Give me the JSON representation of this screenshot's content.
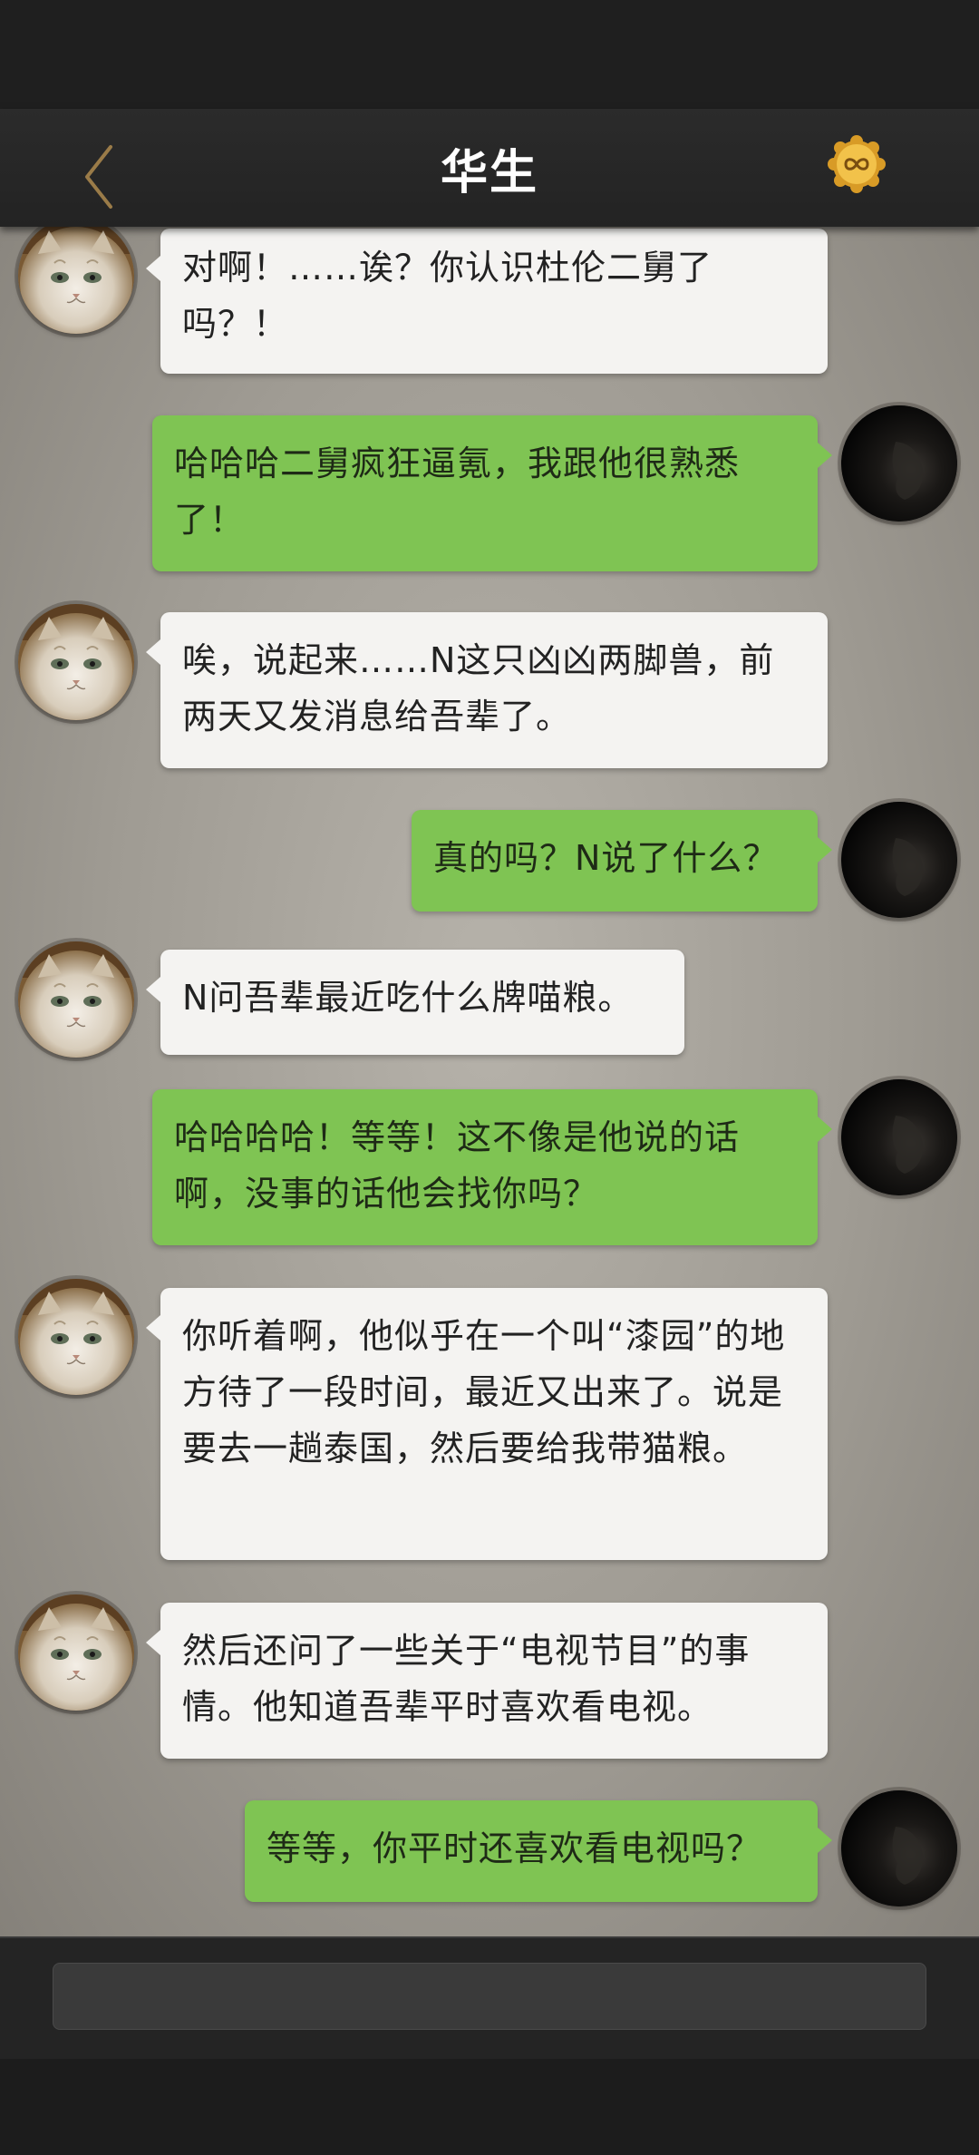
{
  "header": {
    "title": "华生",
    "back_icon": "chevron-left-icon",
    "coin_icon": "infinity-coin-icon"
  },
  "colors": {
    "header_bg": "#2b2b2b",
    "incoming_bubble": "#f4f3f1",
    "outgoing_bubble": "#7fc453",
    "back_icon": "#9a7b48",
    "coin": "#e8b33a"
  },
  "messages": [
    {
      "side": "left",
      "sender": "cat",
      "text": "对啊！……诶？你认识杜伦二舅了吗？！"
    },
    {
      "side": "right",
      "sender": "player",
      "text": "哈哈哈二舅疯狂逼氪，我跟他很熟悉了！"
    },
    {
      "side": "left",
      "sender": "cat",
      "text": "唉，说起来……N这只凶凶两脚兽，前两天又发消息给吾辈了。"
    },
    {
      "side": "right",
      "sender": "player",
      "text": "真的吗？N说了什么？"
    },
    {
      "side": "left",
      "sender": "cat",
      "text": "N问吾辈最近吃什么牌喵粮。"
    },
    {
      "side": "right",
      "sender": "player",
      "text": "哈哈哈哈！等等！这不像是他说的话啊，没事的话他会找你吗？"
    },
    {
      "side": "left",
      "sender": "cat",
      "text": "你听着啊，他似乎在一个叫“漆园”的地方待了一段时间，最近又出来了。说是要去一趟泰国，然后要给我带猫粮。"
    },
    {
      "side": "left",
      "sender": "cat",
      "text": "然后还问了一些关于“电视节目”的事情。他知道吾辈平时喜欢看电视。"
    },
    {
      "side": "right",
      "sender": "player",
      "text": "等等，你平时还喜欢看电视吗？"
    }
  ],
  "input": {
    "value": "",
    "placeholder": ""
  }
}
